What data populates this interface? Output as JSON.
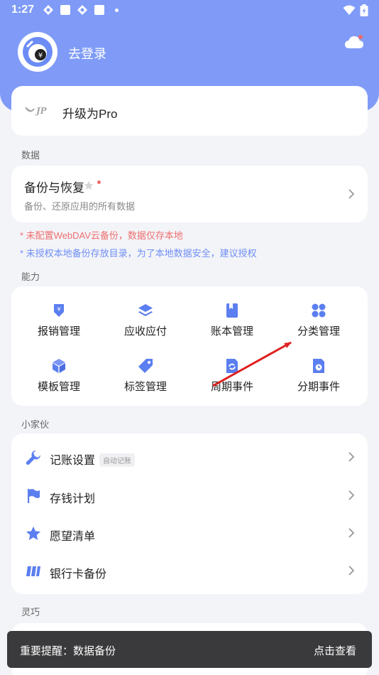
{
  "status_bar": {
    "time": "1:27"
  },
  "header": {
    "login_text": "去登录"
  },
  "pro": {
    "label": "升级为Pro"
  },
  "sections": {
    "data": "数据",
    "abilities": "能力",
    "tools": "小家伙",
    "smart": "灵巧"
  },
  "backup": {
    "title": "备份与恢复",
    "subtitle": "备份、还原应用的所有数据"
  },
  "warnings": {
    "webdav": "* 未配置WebDAV云备份，数据仅存本地",
    "local": "* 未授权本地备份存放目录，为了本地数据安全，建议授权"
  },
  "abilities": [
    {
      "label": "报销管理",
      "icon": "reimburse-icon"
    },
    {
      "label": "应收应付",
      "icon": "layers-icon"
    },
    {
      "label": "账本管理",
      "icon": "ledger-book-icon"
    },
    {
      "label": "分类管理",
      "icon": "category-grid-icon"
    },
    {
      "label": "模板管理",
      "icon": "template-cube-icon"
    },
    {
      "label": "标签管理",
      "icon": "tag-icon"
    },
    {
      "label": "周期事件",
      "icon": "cycle-event-icon"
    },
    {
      "label": "分期事件",
      "icon": "installment-icon"
    }
  ],
  "tools": [
    {
      "label": "记账设置",
      "badge": "自动记账",
      "icon": "wrench-icon"
    },
    {
      "label": "存钱计划",
      "icon": "flag-icon"
    },
    {
      "label": "愿望清单",
      "icon": "star-icon"
    },
    {
      "label": "银行卡备份",
      "icon": "bank-card-icon"
    }
  ],
  "snackbar": {
    "message": "重要提醒：数据备份",
    "action": "点击查看"
  },
  "colors": {
    "header": "#7f9bf7",
    "accent": "#5b7ef0",
    "warn_red": "#ef6f6f",
    "warn_blue": "#6f8ef5",
    "snackbar": "#3a3a3c"
  }
}
